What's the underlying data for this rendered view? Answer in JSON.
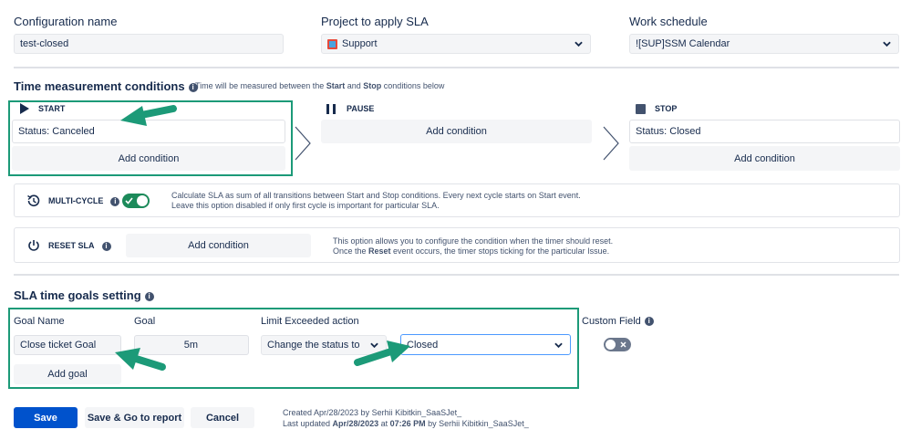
{
  "config": {
    "name_label": "Configuration name",
    "name_value": "test-closed",
    "project_label": "Project to apply SLA",
    "project_value": "Support",
    "schedule_label": "Work schedule",
    "schedule_value": "![SUP]SSM Calendar"
  },
  "time_conditions": {
    "title": "Time measurement conditions",
    "hint_prefix": "Time will be measured between the ",
    "hint_start": "Start",
    "hint_mid": " and ",
    "hint_stop": "Stop",
    "hint_suffix": " conditions below",
    "start": {
      "label": "START",
      "condition": "Status: Canceled",
      "add_label": "Add condition"
    },
    "pause": {
      "label": "PAUSE",
      "add_label": "Add condition"
    },
    "stop": {
      "label": "STOP",
      "condition": "Status: Closed",
      "add_label": "Add condition"
    }
  },
  "multi_cycle": {
    "label": "MULTI-CYCLE",
    "desc_line1": "Calculate SLA as sum of all transitions between Start and Stop conditions. Every next cycle starts on Start event.",
    "desc_line2": "Leave this option disabled if only first cycle is important for particular SLA.",
    "enabled": true
  },
  "reset_sla": {
    "label": "RESET SLA",
    "add_label": "Add condition",
    "desc_line1": "This option allows you to configure the condition when the timer should reset.",
    "desc_line2_prefix": "Once the ",
    "desc_line2_bold": "Reset",
    "desc_line2_suffix": " event occurs, the timer stops ticking for the particular Issue."
  },
  "goals": {
    "title": "SLA time goals setting",
    "goal_name_label": "Goal Name",
    "goal_label": "Goal",
    "limit_label": "Limit Exceeded action",
    "custom_field_label": "Custom Field",
    "goal_name_value": "Close ticket Goal",
    "goal_value": "5m",
    "limit_value": "Change the status to",
    "status_value": "Closed",
    "add_goal_label": "Add goal",
    "custom_field_enabled": false
  },
  "footer": {
    "save_label": "Save",
    "save_report_label": "Save & Go to report",
    "cancel_label": "Cancel",
    "created_line": "Created Apr/28/2023 by Serhii Kibitkin_SaaSJet_",
    "updated_prefix": "Last updated ",
    "updated_date": "Apr/28/2023",
    "updated_mid": " at ",
    "updated_time": "07:26 PM",
    "updated_suffix": " by Serhii Kibitkin_SaaSJet_"
  },
  "colors": {
    "accent": "#1c9a78",
    "primary": "#0052cc",
    "toggle_on": "#1c8a5a"
  }
}
